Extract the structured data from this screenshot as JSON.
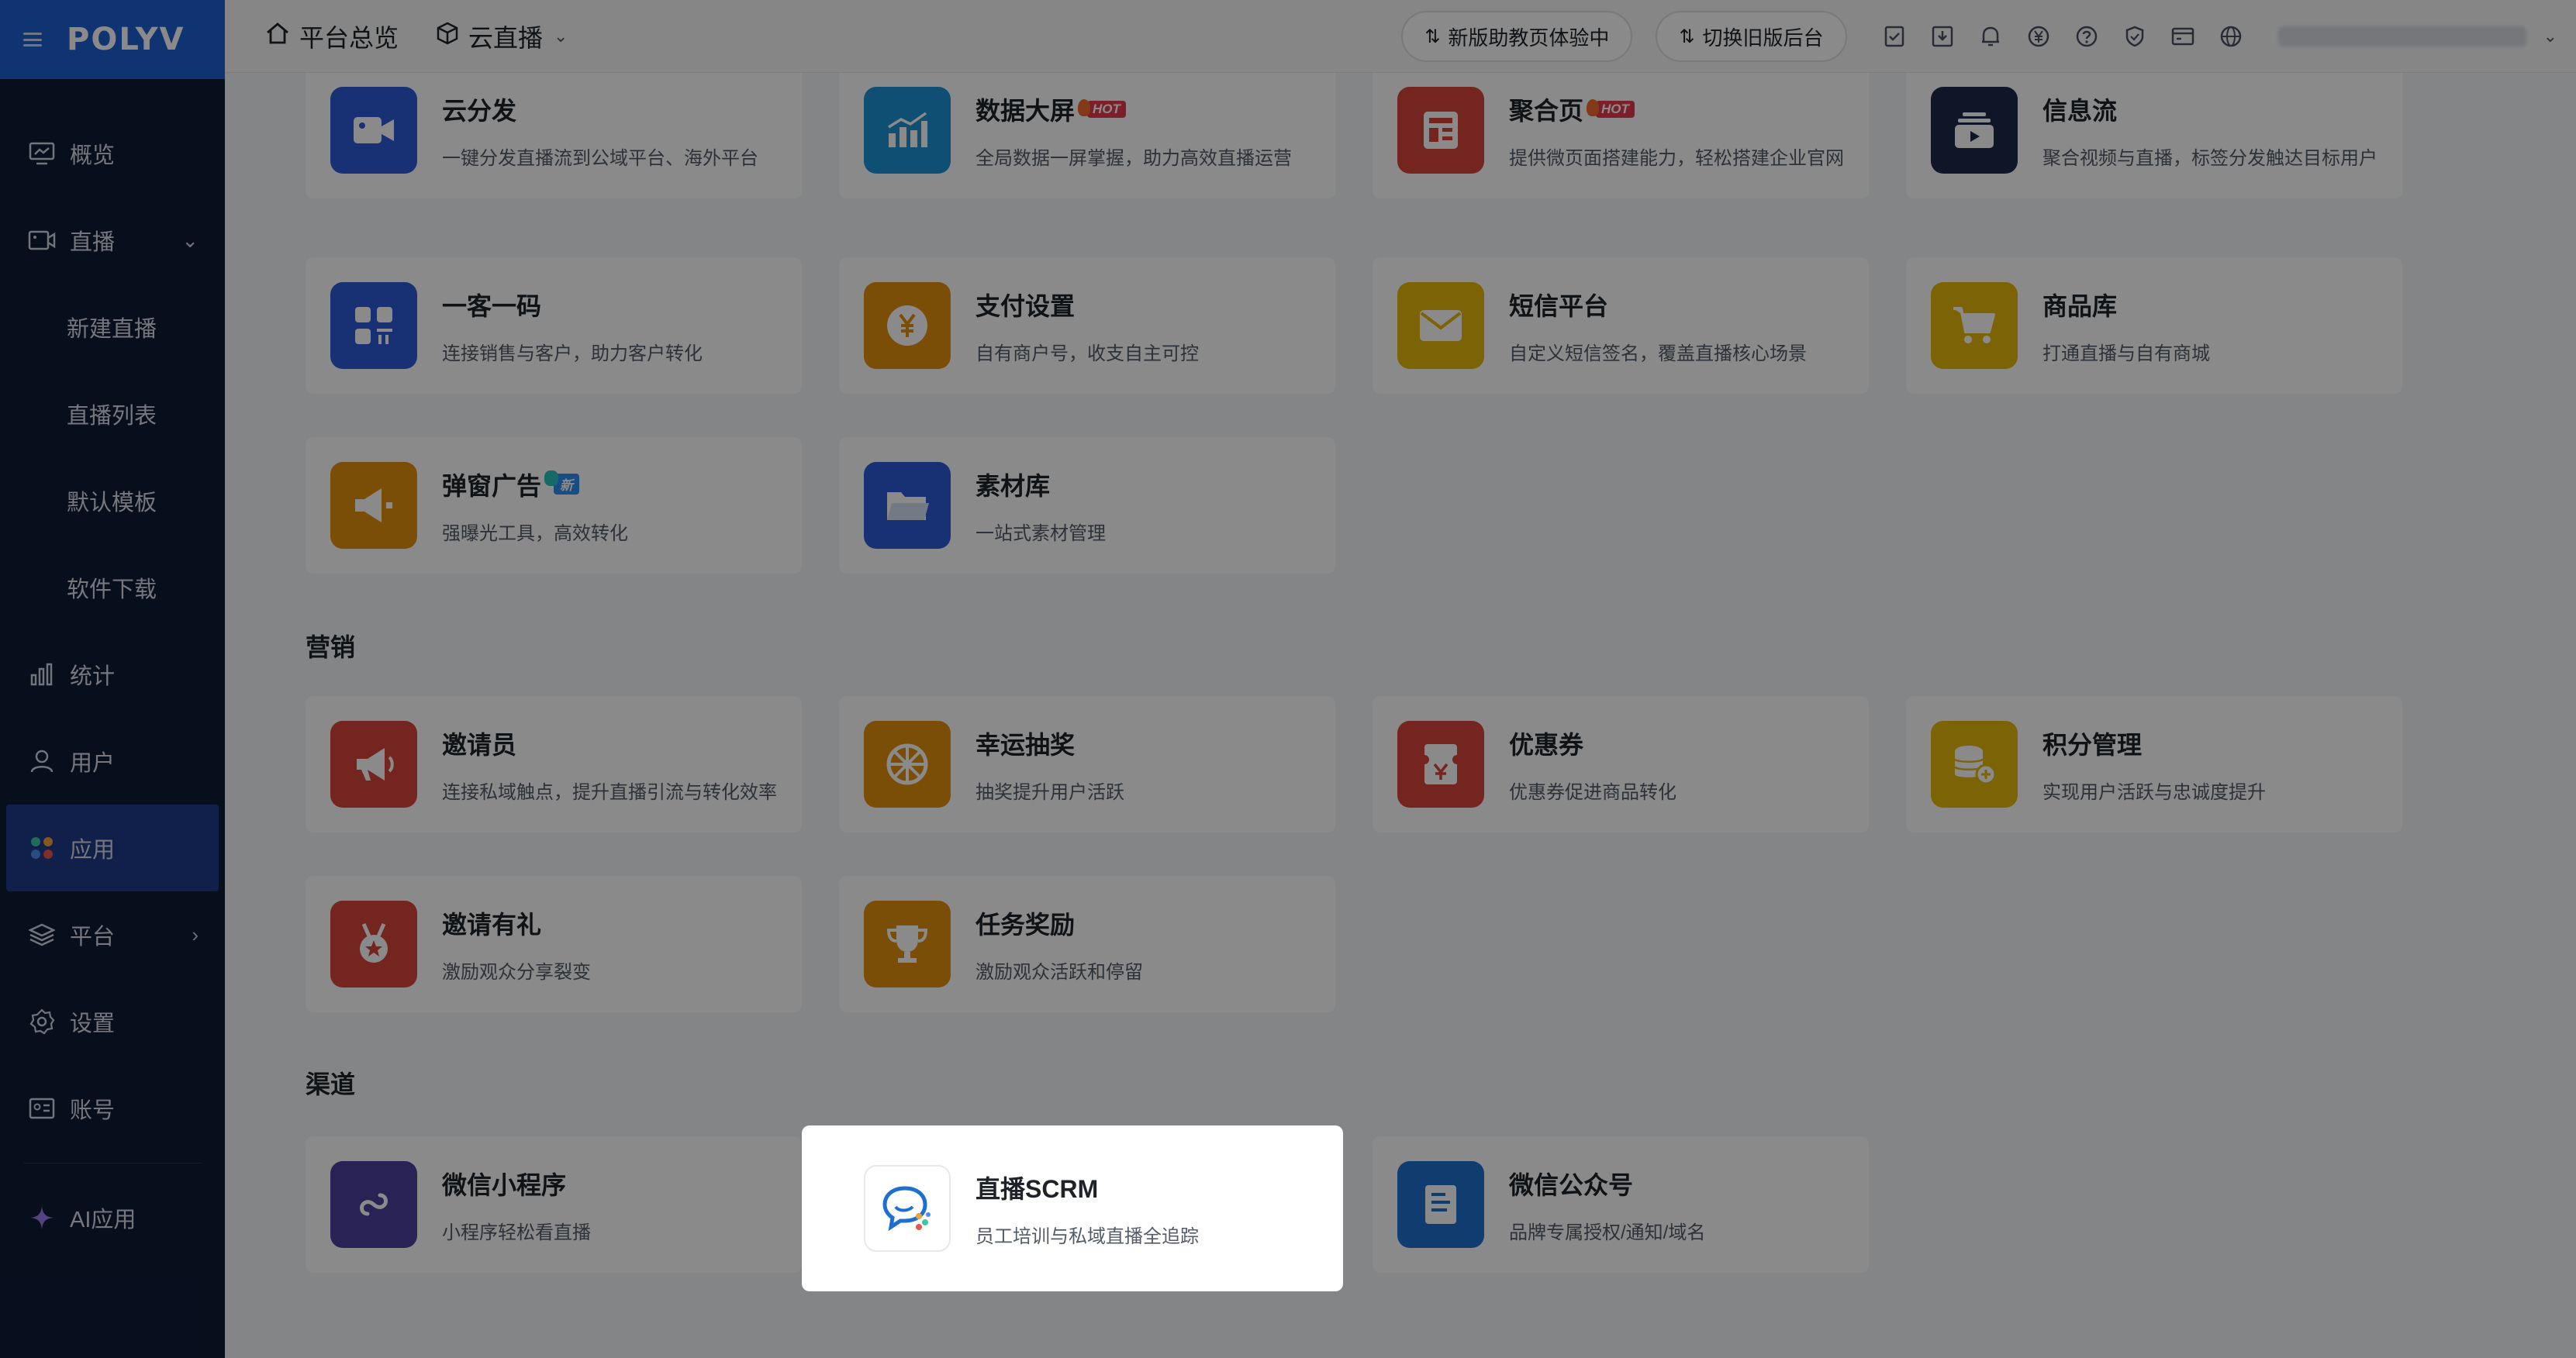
{
  "brand": {
    "logo": "POLYV"
  },
  "topbar": {
    "overview": "平台总览",
    "product": "云直播",
    "new_version_btn": "新版助教页体验中",
    "old_version_btn": "切换旧版后台"
  },
  "sidebar": {
    "items": [
      {
        "label": "概览",
        "icon": "monitor-icon"
      },
      {
        "label": "直播",
        "icon": "video-icon",
        "expanded": true
      },
      {
        "label": "新建直播",
        "sub": true
      },
      {
        "label": "直播列表",
        "sub": true
      },
      {
        "label": "默认模板",
        "sub": true
      },
      {
        "label": "软件下载",
        "sub": true
      },
      {
        "label": "统计",
        "icon": "bar-chart-icon"
      },
      {
        "label": "用户",
        "icon": "user-icon"
      },
      {
        "label": "应用",
        "icon": "apps-icon",
        "active": true
      },
      {
        "label": "平台",
        "icon": "layers-icon"
      },
      {
        "label": "设置",
        "icon": "gear-icon"
      },
      {
        "label": "账号",
        "icon": "id-card-icon"
      },
      {
        "label": "AI应用",
        "icon": "sparkle-icon"
      }
    ]
  },
  "sections": {
    "marketing": "营销",
    "channels": "渠道"
  },
  "apps": {
    "row1": [
      {
        "title": "云分发",
        "desc": "一键分发直播流到公域平台、海外平台",
        "color": "#2e5bd6"
      },
      {
        "title": "数据大屏",
        "desc": "全局数据一屏掌握，助力高效直播运营",
        "color": "#1f93d6",
        "badge": "HOT"
      },
      {
        "title": "聚合页",
        "desc": "提供微页面搭建能力，轻松搭建企业官网",
        "color": "#d9453a",
        "badge": "HOT"
      },
      {
        "title": "信息流",
        "desc": "聚合视频与直播，标签分发触达目标用户",
        "color": "#1d2a4a"
      }
    ],
    "row2": [
      {
        "title": "一客一码",
        "desc": "连接销售与客户，助力客户转化",
        "color": "#2e5bd6"
      },
      {
        "title": "支付设置",
        "desc": "自有商户号，收支自主可控",
        "color": "#e3910e"
      },
      {
        "title": "短信平台",
        "desc": "自定义短信签名，覆盖直播核心场景",
        "color": "#e6b70b"
      },
      {
        "title": "商品库",
        "desc": "打通直播与自有商城",
        "color": "#e6b70b"
      }
    ],
    "row3": [
      {
        "title": "弹窗广告",
        "desc": "强曝光工具，高效转化",
        "color": "#e3910e",
        "badge": "新"
      },
      {
        "title": "素材库",
        "desc": "一站式素材管理",
        "color": "#2e5bd6"
      }
    ],
    "marketing": [
      {
        "title": "邀请员",
        "desc": "连接私域触点，提升直播引流与转化效率",
        "color": "#d9453a"
      },
      {
        "title": "幸运抽奖",
        "desc": "抽奖提升用户活跃",
        "color": "#e3910e"
      },
      {
        "title": "优惠券",
        "desc": "优惠券促进商品转化",
        "color": "#d9453a"
      },
      {
        "title": "积分管理",
        "desc": "实现用户活跃与忠诚度提升",
        "color": "#e6b70b"
      }
    ],
    "marketing2": [
      {
        "title": "邀请有礼",
        "desc": "激励观众分享裂变",
        "color": "#d9453a"
      },
      {
        "title": "任务奖励",
        "desc": "激励观众活跃和停留",
        "color": "#e3910e"
      }
    ],
    "channels": [
      {
        "title": "微信小程序",
        "desc": "小程序轻松看直播",
        "color": "#4a3f9e"
      },
      {
        "title": "直播SCRM",
        "desc": "员工培训与私域直播全追踪",
        "color": "#ffffff"
      },
      {
        "title": "微信公众号",
        "desc": "品牌专属授权/通知/域名",
        "color": "#1f6fd0"
      }
    ]
  }
}
